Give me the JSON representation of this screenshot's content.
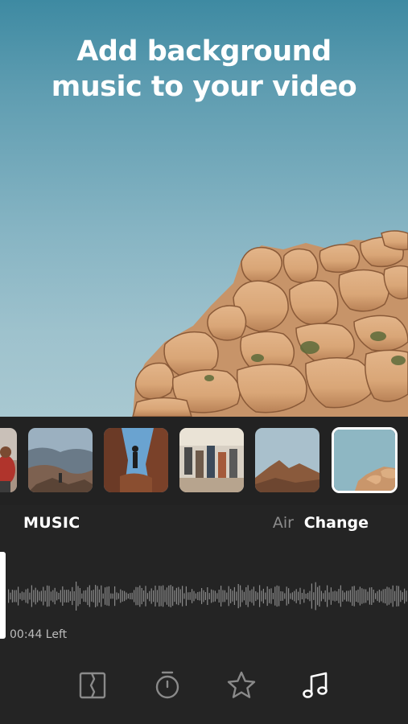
{
  "preview": {
    "headline_line1": "Add background",
    "headline_line2": "music to your video"
  },
  "thumbnails": [
    {
      "id": "clip-1",
      "scene": "hikers-partial",
      "selected": false
    },
    {
      "id": "clip-2",
      "scene": "canyon-lookout",
      "selected": false
    },
    {
      "id": "clip-3",
      "scene": "hiker-silhouette",
      "selected": false
    },
    {
      "id": "clip-4",
      "scene": "hiking-group",
      "selected": false
    },
    {
      "id": "clip-5",
      "scene": "desert-mountain",
      "selected": false
    },
    {
      "id": "clip-6",
      "scene": "sky-rocks",
      "selected": true
    }
  ],
  "music": {
    "section_label": "MUSIC",
    "track_name": "Air",
    "change_label": "Change",
    "time_left": "00:44 Left"
  },
  "toolbar": {
    "tools": [
      {
        "name": "trim-tool",
        "icon": "trim-icon"
      },
      {
        "name": "timer-tool",
        "icon": "stopwatch-icon"
      },
      {
        "name": "effects-tool",
        "icon": "star-icon"
      },
      {
        "name": "music-tool",
        "icon": "music-note-icon",
        "active": true
      }
    ]
  },
  "colors": {
    "background": "#242424",
    "accent_text": "#ffffff",
    "muted_text": "#8c8c8c",
    "waveform": "#8a8a8a"
  }
}
